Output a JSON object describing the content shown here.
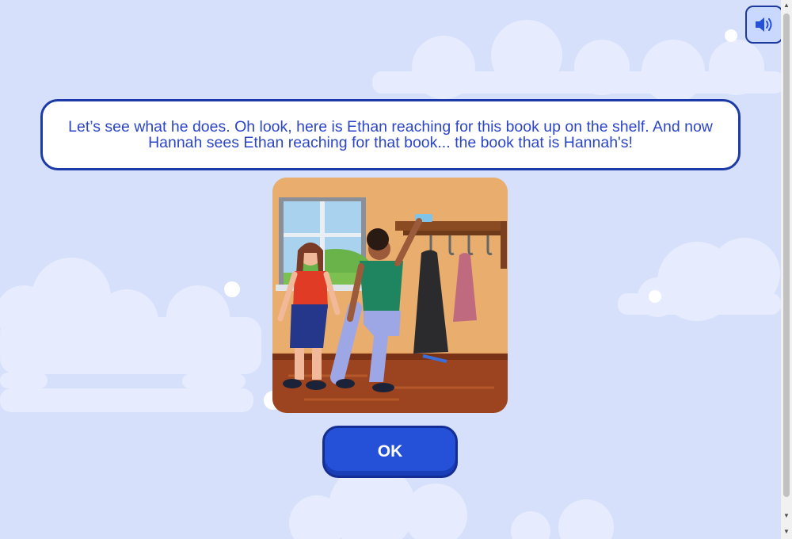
{
  "dialog": {
    "text": "Let’s see what he does. Oh look, here is Ethan reaching for this book up on the shelf. And now Hannah sees Ethan reaching for that book... the book that is Hannah's!"
  },
  "buttons": {
    "ok_label": "OK",
    "sound_icon": "speaker-volume-icon"
  },
  "scrollbar": {
    "up_glyph": "▲",
    "down_glyph": "▼"
  },
  "colors": {
    "background": "#d6e0fb",
    "accent": "#2550d8",
    "text": "#2b45c9",
    "border": "#1c3aa8"
  }
}
